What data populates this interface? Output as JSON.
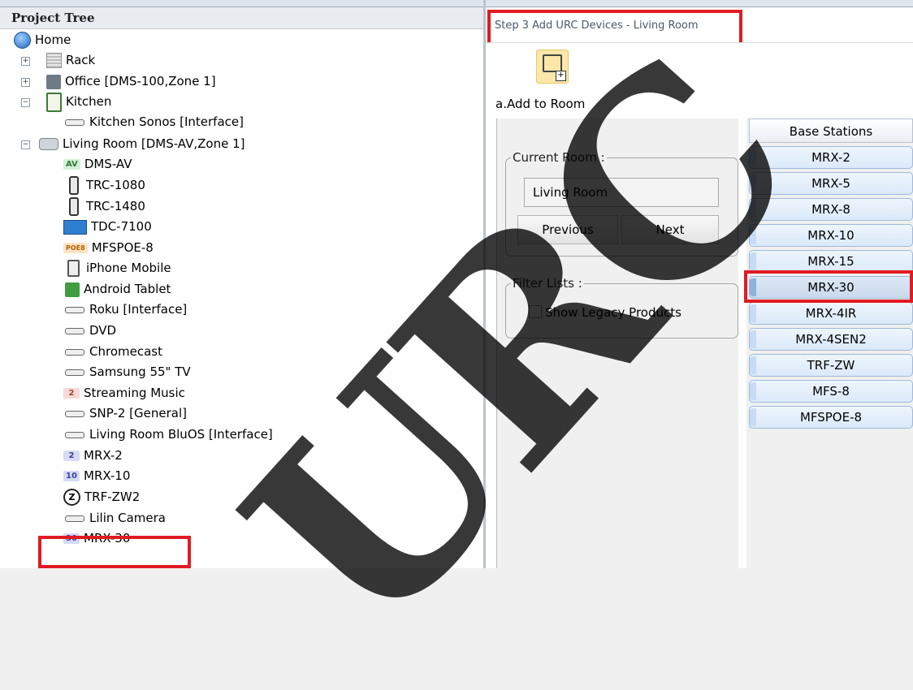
{
  "project_tree": {
    "title": "Project Tree",
    "items": [
      {
        "label": "Home"
      },
      {
        "label": "Rack"
      },
      {
        "label": "Office [DMS-100,Zone 1]"
      },
      {
        "label": "Kitchen"
      },
      {
        "label": "Kitchen Sonos [Interface]"
      },
      {
        "label": "Living Room [DMS-AV,Zone 1]"
      },
      {
        "label": "DMS-AV",
        "badge": "AV"
      },
      {
        "label": "TRC-1080"
      },
      {
        "label": "TRC-1480"
      },
      {
        "label": "TDC-7100"
      },
      {
        "label": "MFSPOE-8",
        "badge": "POE8"
      },
      {
        "label": "iPhone Mobile"
      },
      {
        "label": "Android Tablet"
      },
      {
        "label": "Roku [Interface]"
      },
      {
        "label": "DVD"
      },
      {
        "label": "Chromecast"
      },
      {
        "label": "Samsung 55\" TV"
      },
      {
        "label": "Streaming Music",
        "badge": "2"
      },
      {
        "label": "SNP-2 [General]"
      },
      {
        "label": "Living Room BluOS [Interface]"
      },
      {
        "label": "MRX-2",
        "badge": "2"
      },
      {
        "label": "MRX-10",
        "badge": "10"
      },
      {
        "label": "TRF-ZW2",
        "badge": "Z"
      },
      {
        "label": "Lilin Camera"
      },
      {
        "label": "MRX-30",
        "badge": "30"
      }
    ],
    "expanders": {
      "rack": "+",
      "office": "+",
      "kitchen": "−",
      "living_room": "−"
    }
  },
  "wizard": {
    "step_title": "Step 3 Add URC Devices - Living Room",
    "add_to_room_label": "a.Add to Room",
    "current_room": {
      "title": "Current Room :",
      "value": "Living Room",
      "previous_label": "Previous",
      "next_label": "Next"
    },
    "filter": {
      "title": "Filter Lists :",
      "show_legacy_label": "Show Legacy Products",
      "show_legacy_checked": false
    }
  },
  "base_stations": {
    "header": "Base Stations",
    "items": [
      "MRX-2",
      "MRX-5",
      "MRX-8",
      "MRX-10",
      "MRX-15",
      "MRX-30",
      "MRX-4IR",
      "MRX-4SEN2",
      "TRF-ZW",
      "MFS-8",
      "MFSPOE-8"
    ],
    "selected": "MRX-30"
  },
  "watermark": "URC",
  "colors": {
    "highlight": "#e11b22",
    "list_item": "#dbe9f9",
    "accent": "#2266bb"
  }
}
